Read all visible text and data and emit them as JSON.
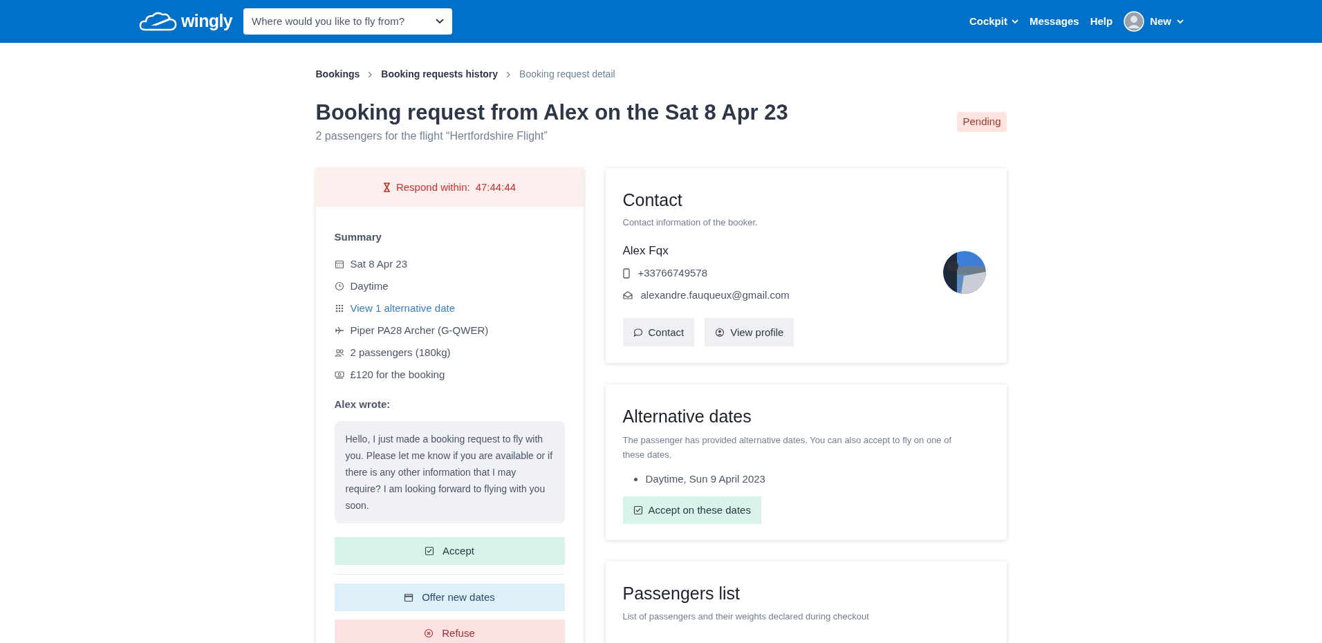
{
  "header": {
    "logo": "wingly",
    "search": {
      "placeholder": "Where would you like to fly from?"
    },
    "nav": [
      {
        "label": "Cockpit",
        "kind": "dropdown"
      },
      {
        "label": "Messages",
        "kind": "link"
      },
      {
        "label": "Help",
        "kind": "link"
      },
      {
        "label": "New",
        "kind": "account"
      }
    ]
  },
  "breadcrumbs": [
    {
      "label": "Bookings",
      "current": false
    },
    {
      "label": "Booking requests history",
      "current": false
    },
    {
      "label": "Booking request detail",
      "current": true
    }
  ],
  "title": "Booking request from Alex on the Sat 8 Apr 23",
  "subtitle": "2 passengers for the flight “Hertfordshire Flight”",
  "status": "Pending",
  "summary_card": {
    "timer_label": "Respond within:",
    "timer": "47:44:44",
    "heading": "Summary",
    "items": [
      {
        "text": "Sat 8 Apr 23",
        "kind": "text"
      },
      {
        "text": "Daytime",
        "kind": "text"
      },
      {
        "text": "View 1 alternative date",
        "kind": "link"
      },
      {
        "text": "Piper PA28 Archer (G-QWER)",
        "kind": "text"
      },
      {
        "text": "2 passengers (180kg)",
        "kind": "text"
      },
      {
        "text": "£120 for the booking",
        "kind": "text"
      }
    ],
    "message_label": "Alex wrote:",
    "message": "Hello, I just made a booking request to fly with you. Please let me know if you are available or if there is any other information that I may require? I am looking forward to flying with you soon.",
    "actions": [
      {
        "label": "Accept",
        "kind": "accept"
      },
      {
        "label": "Offer new dates",
        "kind": "offer"
      },
      {
        "label": "Refuse",
        "kind": "refuse"
      }
    ]
  },
  "contact": {
    "title": "Contact",
    "description": "Contact information of the booker.",
    "name": "Alex Fqx",
    "phone": "+33766749578",
    "email": "alexandre.fauqueux@gmail.com",
    "buttons": [
      {
        "label": "Contact",
        "kind": "chat"
      },
      {
        "label": "View profile",
        "kind": "profile"
      }
    ]
  },
  "alternative_dates": {
    "title": "Alternative dates",
    "description": "The passenger has provided alternative dates. You can also accept to fly on one of these dates.",
    "dates": [
      "Daytime, Sun 9 April 2023"
    ],
    "button": "Accept on these dates"
  },
  "passengers": {
    "title": "Passengers list",
    "description": "List of passengers and their weights declared during checkout"
  }
}
